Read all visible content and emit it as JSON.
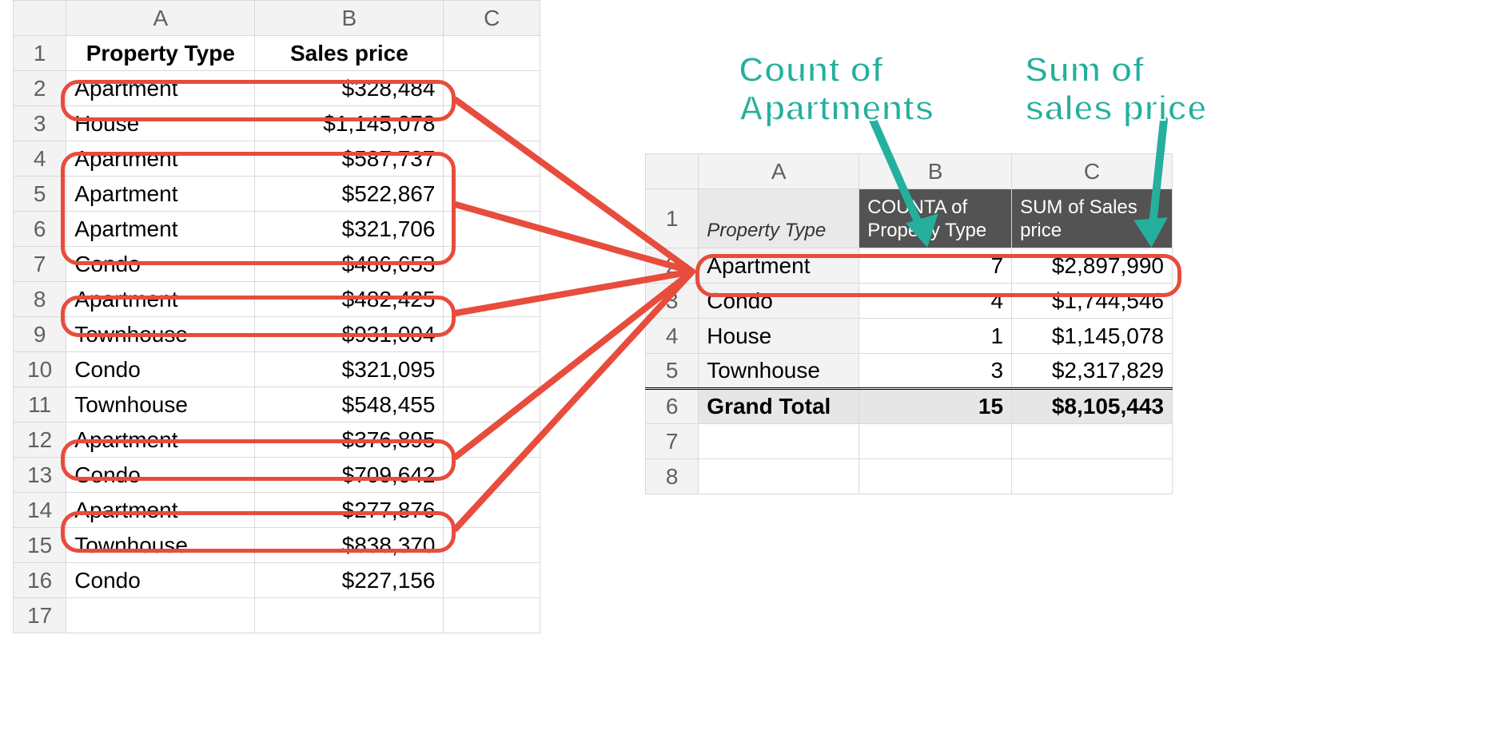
{
  "left": {
    "columns": [
      "A",
      "B",
      "C"
    ],
    "headers": {
      "a": "Property Type",
      "b": "Sales price"
    },
    "rows": [
      {
        "n": "1"
      },
      {
        "n": "2",
        "a": "Apartment",
        "b": "$328,484",
        "hl": true
      },
      {
        "n": "3",
        "a": "House",
        "b": "$1,145,078"
      },
      {
        "n": "4",
        "a": "Apartment",
        "b": "$587,737",
        "hl": "group"
      },
      {
        "n": "5",
        "a": "Apartment",
        "b": "$522,867",
        "hl": "group"
      },
      {
        "n": "6",
        "a": "Apartment",
        "b": "$321,706",
        "hl": "group"
      },
      {
        "n": "7",
        "a": "Condo",
        "b": "$486,653"
      },
      {
        "n": "8",
        "a": "Apartment",
        "b": "$482,425",
        "hl": true
      },
      {
        "n": "9",
        "a": "Townhouse",
        "b": "$931,004"
      },
      {
        "n": "10",
        "a": "Condo",
        "b": "$321,095"
      },
      {
        "n": "11",
        "a": "Townhouse",
        "b": "$548,455"
      },
      {
        "n": "12",
        "a": "Apartment",
        "b": "$376,895",
        "hl": true
      },
      {
        "n": "13",
        "a": "Condo",
        "b": "$709,642"
      },
      {
        "n": "14",
        "a": "Apartment",
        "b": "$277,876",
        "hl": true
      },
      {
        "n": "15",
        "a": "Townhouse",
        "b": "$838,370"
      },
      {
        "n": "16",
        "a": "Condo",
        "b": "$227,156"
      },
      {
        "n": "17"
      }
    ]
  },
  "pivot": {
    "columns": [
      "A",
      "B",
      "C"
    ],
    "headers": {
      "a": "Property Type",
      "b": "COUNTA of Property Type",
      "c": "SUM of Sales price"
    },
    "rows": [
      {
        "n": "2",
        "a": "Apartment",
        "b": "7",
        "c": "$2,897,990",
        "hl": true
      },
      {
        "n": "3",
        "a": "Condo",
        "b": "4",
        "c": "$1,744,546"
      },
      {
        "n": "4",
        "a": "House",
        "b": "1",
        "c": "$1,145,078"
      },
      {
        "n": "5",
        "a": "Townhouse",
        "b": "3",
        "c": "$2,317,829"
      }
    ],
    "total": {
      "n": "6",
      "a": "Grand Total",
      "b": "15",
      "c": "$8,105,443"
    },
    "emptyRows": [
      "7",
      "8"
    ]
  },
  "annotations": {
    "count": "Count of Apartments",
    "sum": "Sum of sales price"
  }
}
